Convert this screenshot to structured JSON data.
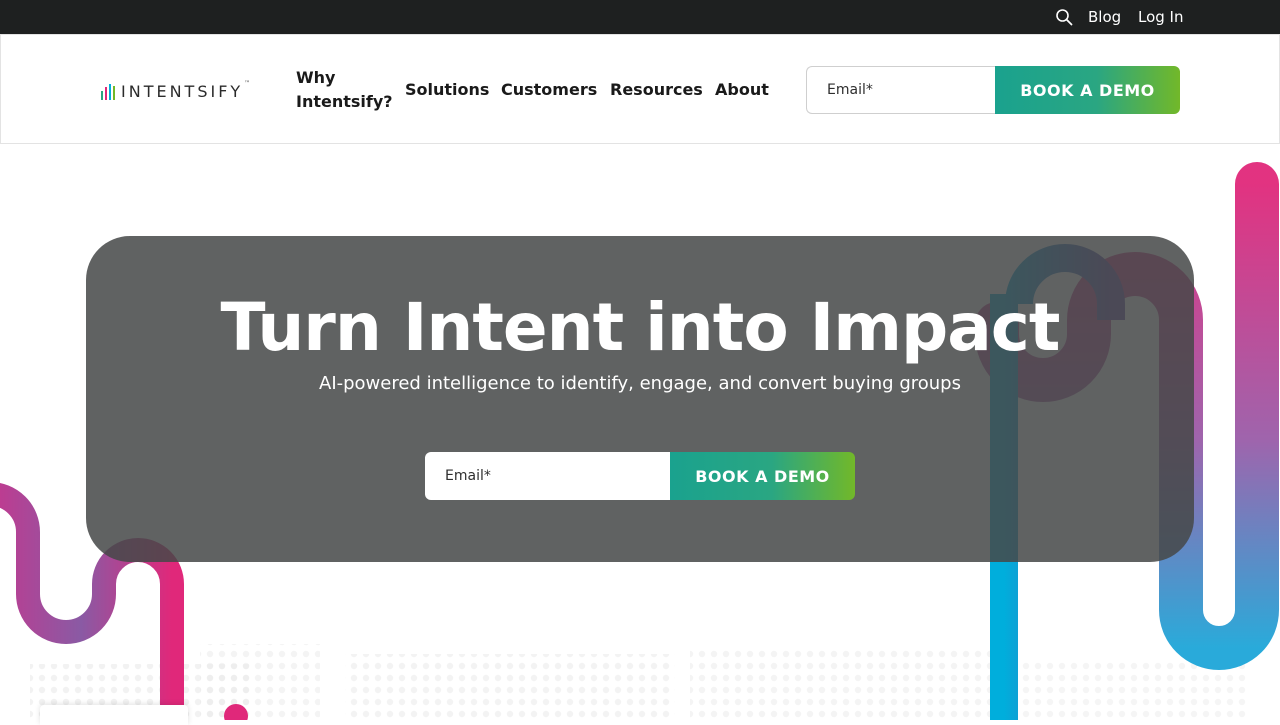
{
  "topbar": {
    "search_icon": "search-icon",
    "blog_label": "Blog",
    "login_label": "Log In"
  },
  "header": {
    "logo_text": "INTENTSIFY",
    "logo_tm": "™",
    "nav": [
      {
        "line1": "Why",
        "line2": "Intentsify?"
      },
      {
        "label": "Solutions"
      },
      {
        "label": "Customers"
      },
      {
        "label": "Resources"
      },
      {
        "label": "About"
      }
    ],
    "email_placeholder": "Email*",
    "cta_label": "BOOK A DEMO"
  },
  "hero": {
    "title": "Turn Intent into Impact",
    "subtitle": "AI-powered intelligence to identify, engage, and convert buying groups",
    "email_placeholder": "Email*",
    "cta_label": "BOOK A DEMO"
  },
  "colors": {
    "topbar_bg": "#1e2020",
    "cta_gradient_start": "#1aa28e",
    "cta_gradient_end": "#72b829",
    "hero_overlay": "#474848",
    "accent_pink": "#e0287a",
    "accent_blue": "#00aedc"
  }
}
